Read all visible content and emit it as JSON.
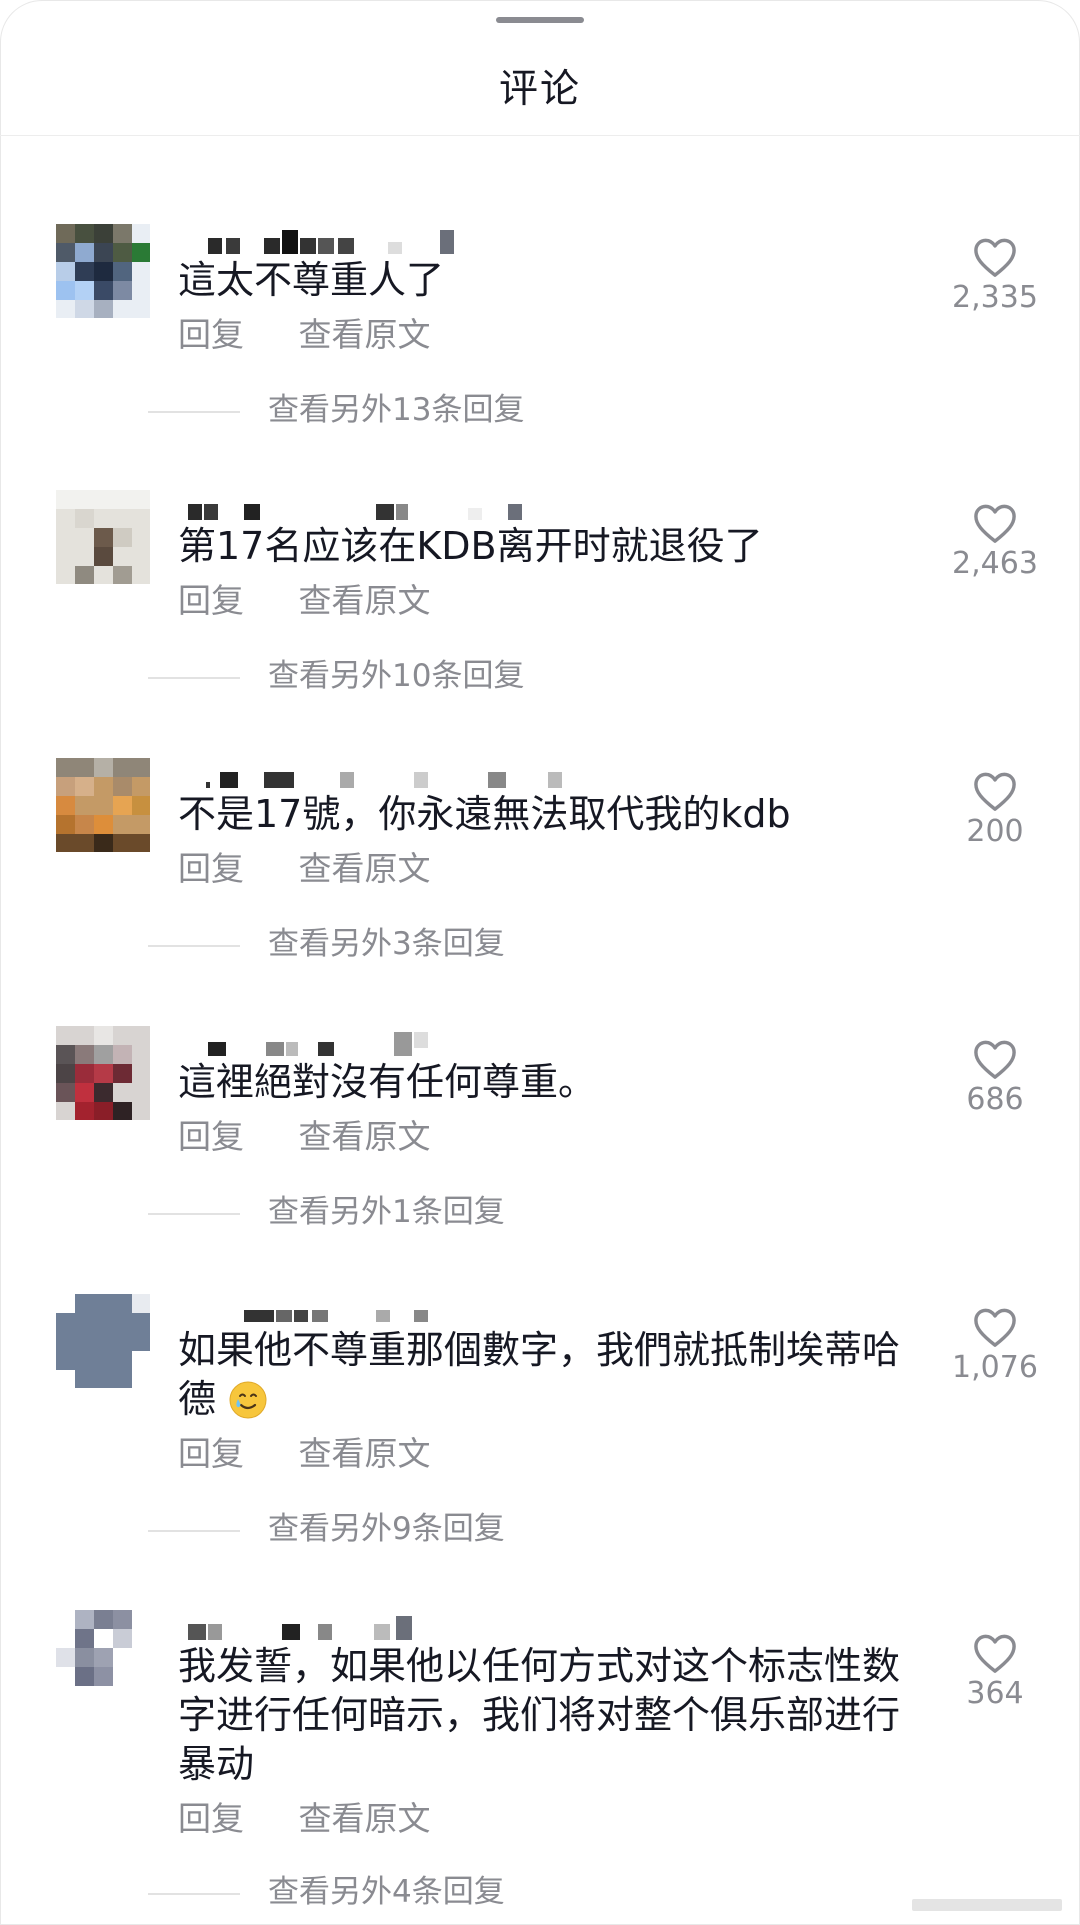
{
  "panel": {
    "title": "评论"
  },
  "labels": {
    "reply": "回复",
    "view_original": "查看原文"
  },
  "comments": [
    {
      "text": "這太不尊重人了",
      "likes": "2,335",
      "more_replies": "查看另外13条回复"
    },
    {
      "text": "第17名应该在KDB离开时就退役了",
      "likes": "2,463",
      "more_replies": "查看另外10条回复"
    },
    {
      "text": "不是17號，你永遠無法取代我的kdb",
      "likes": "200",
      "more_replies": "查看另外3条回复"
    },
    {
      "text": "這裡絕對沒有任何尊重。",
      "likes": "686",
      "more_replies": "查看另外1条回复"
    },
    {
      "text": "如果他不尊重那個數字，我們就抵制埃蒂哈德",
      "likes": "1,076",
      "more_replies": "查看另外9条回复"
    },
    {
      "text": "我发誓，如果他以任何方式对这个标志性数字进行任何暗示，我们将对整个俱乐部进行暴动",
      "likes": "364",
      "more_replies": "查看另外4条回复"
    }
  ],
  "icons": {
    "like": "heart-outline-icon",
    "emoji": "smiling-face-with-tear-emoji"
  },
  "colors": {
    "text": "#161823",
    "secondary": "#8a8b91"
  }
}
